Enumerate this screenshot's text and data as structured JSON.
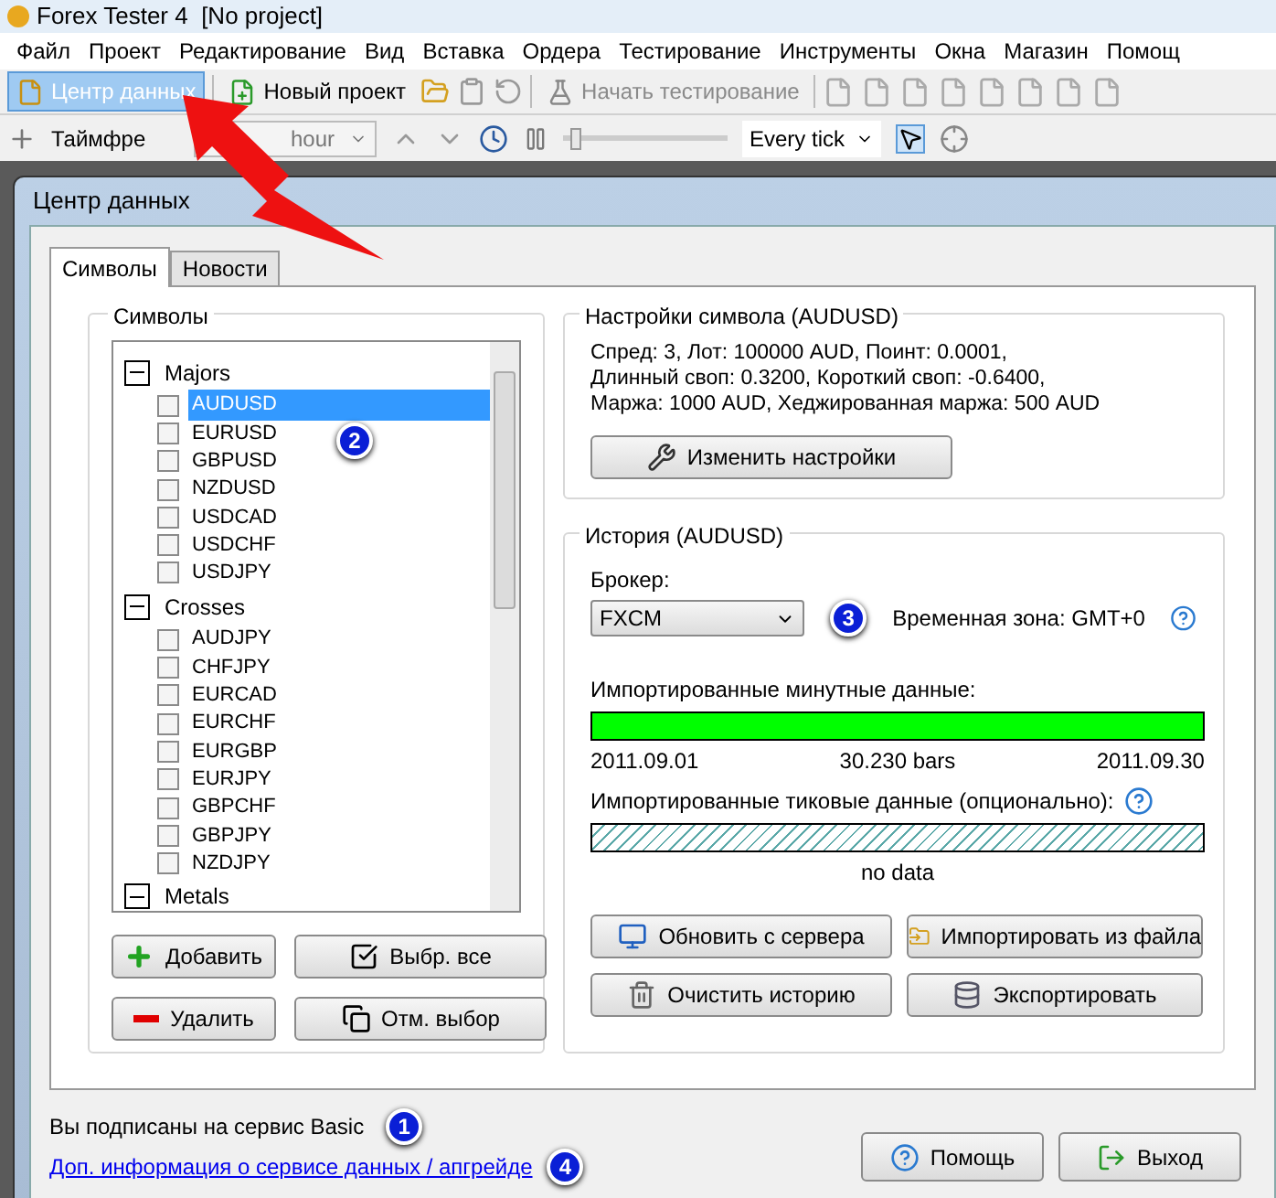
{
  "window": {
    "title": "Forex Tester 4  [No project]"
  },
  "menu": [
    "Файл",
    "Проект",
    "Редактирование",
    "Вид",
    "Вставка",
    "Ордера",
    "Тестирование",
    "Инструменты",
    "Окна",
    "Магазин",
    "Помощ"
  ],
  "toolbar": {
    "buttons": [
      {
        "label": "Центр данных",
        "selected": true,
        "disabled": false
      },
      {
        "label": "Новый проект",
        "selected": false,
        "disabled": false
      },
      {
        "label": "Начать тестирование",
        "selected": false,
        "disabled": true
      }
    ]
  },
  "toolbar2": {
    "timeframe_label": "Таймфре",
    "timeframe_value": "hour",
    "speed": {
      "level": 0.05
    },
    "tick_mode": "Every tick"
  },
  "dialog": {
    "title": "Центр данных",
    "tabs": [
      {
        "label": "Символы",
        "selected": true
      },
      {
        "label": "Новости",
        "selected": false
      }
    ],
    "symbols": {
      "title": "Символы",
      "badge": "2",
      "groups": [
        {
          "name": "Majors",
          "expanded": true,
          "items": [
            {
              "label": "AUDUSD",
              "checked": false,
              "selected": true
            },
            {
              "label": "EURUSD",
              "checked": false,
              "selected": false
            },
            {
              "label": "GBPUSD",
              "checked": false,
              "selected": false
            },
            {
              "label": "NZDUSD",
              "checked": false,
              "selected": false
            },
            {
              "label": "USDCAD",
              "checked": false,
              "selected": false
            },
            {
              "label": "USDCHF",
              "checked": false,
              "selected": false
            },
            {
              "label": "USDJPY",
              "checked": false,
              "selected": false
            }
          ]
        },
        {
          "name": "Crosses",
          "expanded": true,
          "items": [
            {
              "label": "AUDJPY",
              "checked": false,
              "selected": false
            },
            {
              "label": "CHFJPY",
              "checked": false,
              "selected": false
            },
            {
              "label": "EURCAD",
              "checked": false,
              "selected": false
            },
            {
              "label": "EURCHF",
              "checked": false,
              "selected": false
            },
            {
              "label": "EURGBP",
              "checked": false,
              "selected": false
            },
            {
              "label": "EURJPY",
              "checked": false,
              "selected": false
            },
            {
              "label": "GBPCHF",
              "checked": false,
              "selected": false
            },
            {
              "label": "GBPJPY",
              "checked": false,
              "selected": false
            },
            {
              "label": "NZDJPY",
              "checked": false,
              "selected": false
            }
          ]
        },
        {
          "name": "Metals",
          "expanded": true
        }
      ],
      "buttons": [
        {
          "kind": "add",
          "label": "Добавить"
        },
        {
          "kind": "select_all",
          "label": "Выбр. все"
        },
        {
          "kind": "remove",
          "label": "Удалить"
        },
        {
          "kind": "deselect",
          "label": "Отм. выбор"
        }
      ]
    },
    "settings": {
      "title": "Настройки символа (AUDUSD)",
      "lines": [
        "Спред: 3, Лот: 100000 AUD, Поинт: 0.0001,",
        "Длинный своп: 0.3200, Короткий своп: -0.6400,",
        "Маржа: 1000 AUD, Хеджированная маржа: 500 AUD"
      ],
      "button": "Изменить настройки"
    },
    "history": {
      "title": "История (AUDUSD)",
      "broker_label": "Брокер:",
      "broker": "FXCM",
      "badge": "3",
      "timezone": "Временная зона: GMT+0",
      "minute_label": "Импортированные минутные данные:",
      "minute": {
        "level": 1,
        "start": "2011.09.01",
        "count": "30.230 bars",
        "end": "2011.09.30"
      },
      "tick_label": "Импортированные тиковые данные (опционально):",
      "tick": {
        "status": "no data"
      },
      "buttons": [
        {
          "kind": "update",
          "label": "Обновить с сервера"
        },
        {
          "kind": "import",
          "label": "Импортировать из файла"
        },
        {
          "kind": "clear",
          "label": "Очистить историю"
        },
        {
          "kind": "export",
          "label": "Экспортировать"
        }
      ]
    },
    "footer": {
      "subscription": "Вы подписаны на сервис Basic",
      "subscription_badge": "1",
      "link": "Доп. информация о сервисе данных / апгрейде",
      "link_badge": "4",
      "buttons": [
        {
          "kind": "help",
          "label": "Помощь"
        },
        {
          "kind": "exit",
          "label": "Выход"
        }
      ]
    }
  }
}
